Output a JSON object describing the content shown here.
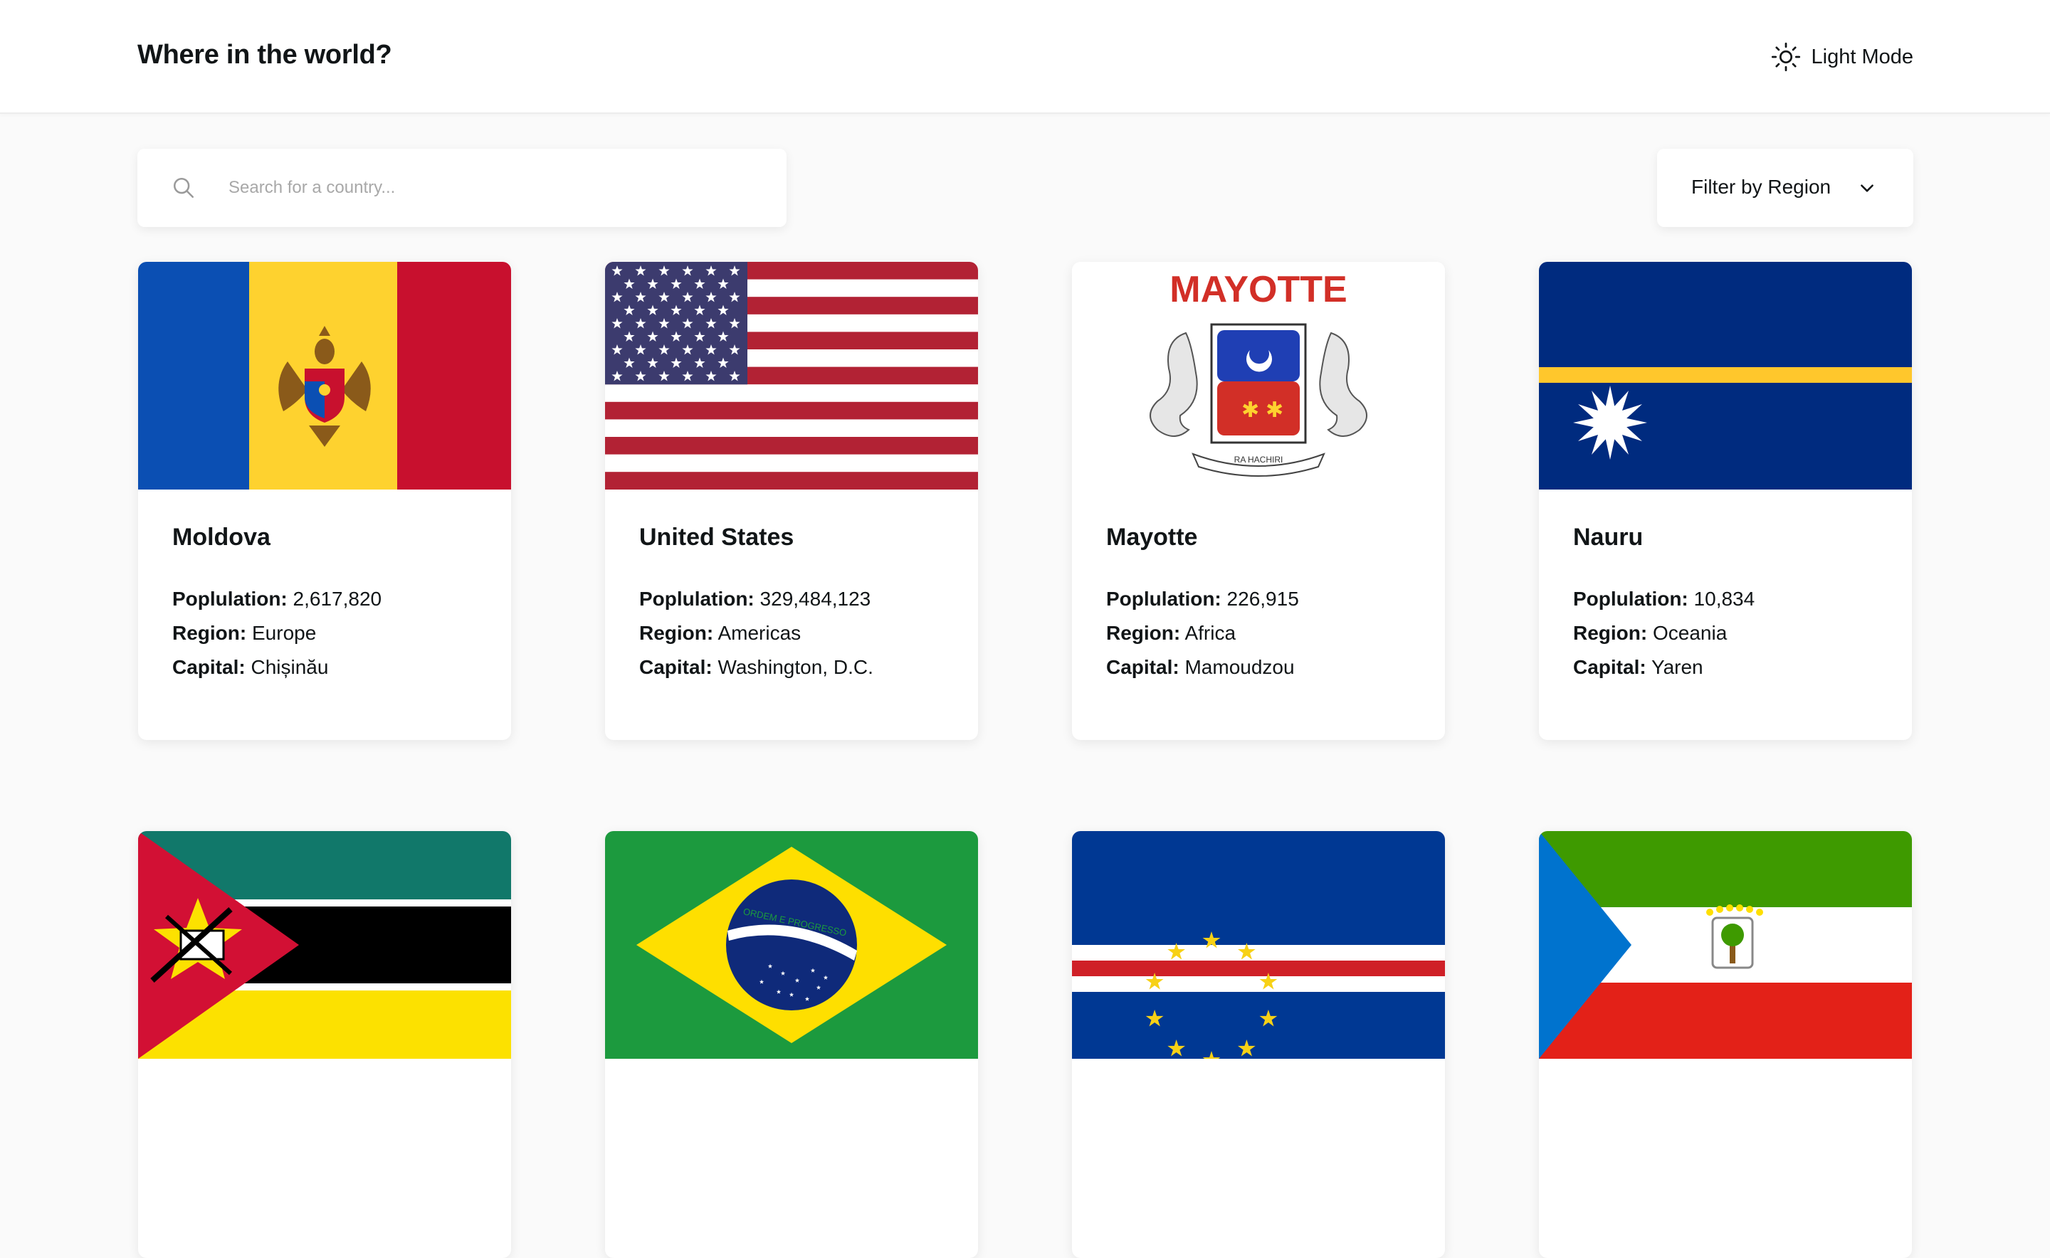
{
  "header": {
    "title": "Where in the world?",
    "mode_label": "Light Mode",
    "mode_icon": "sun-icon"
  },
  "search": {
    "placeholder": "Search for a country...",
    "value": "",
    "icon": "search-icon"
  },
  "filter": {
    "label": "Filter by Region",
    "icon": "chevron-down-icon"
  },
  "stat_labels": {
    "population": "Poplulation:",
    "region": "Region:",
    "capital": "Capital:"
  },
  "countries": [
    {
      "name": "Moldova",
      "population": "2,617,820",
      "region": "Europe",
      "capital": "Chișinău"
    },
    {
      "name": "United States",
      "population": "329,484,123",
      "region": "Americas",
      "capital": "Washington, D.C."
    },
    {
      "name": "Mayotte",
      "population": "226,915",
      "region": "Africa",
      "capital": "Mamoudzou",
      "flag_text": "MAYOTTE",
      "flag_motto": "RA HACHIRI"
    },
    {
      "name": "Nauru",
      "population": "10,834",
      "region": "Oceania",
      "capital": "Yaren"
    },
    {
      "flag": "Mozambique"
    },
    {
      "flag": "Brazil",
      "flag_motto": "ORDEM E PROGRESSO"
    },
    {
      "flag": "Cape Verde"
    },
    {
      "flag": "Equatorial Guinea"
    }
  ],
  "colors": {
    "background": "#fafafa",
    "card": "#ffffff",
    "text": "#111517",
    "placeholder": "#a8a8a8"
  }
}
